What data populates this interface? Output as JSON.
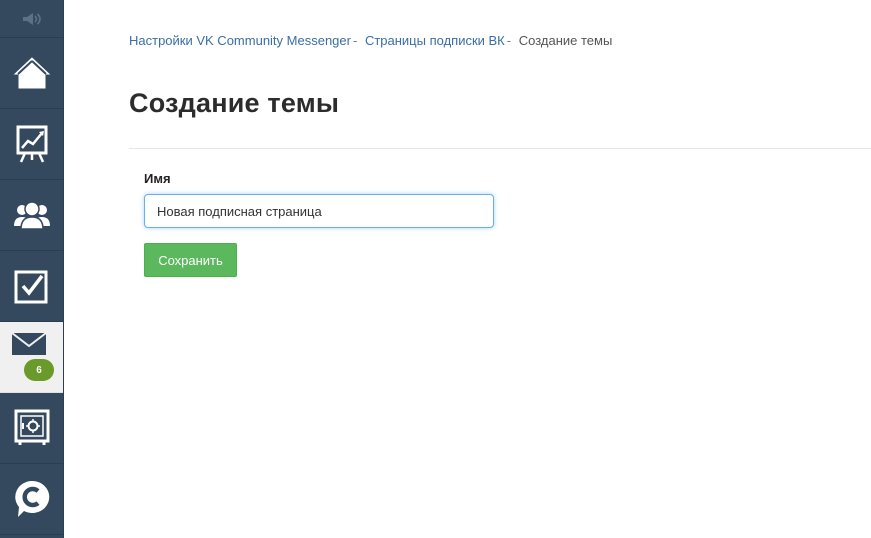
{
  "sidebar": {
    "items": [
      {
        "icon": "home-icon"
      },
      {
        "icon": "chart-easel-icon"
      },
      {
        "icon": "users-icon"
      },
      {
        "icon": "checkbox-icon"
      },
      {
        "icon": "mail-icon",
        "badge": "6",
        "active": true
      },
      {
        "icon": "safe-icon"
      },
      {
        "icon": "chat-bubble-icon"
      }
    ],
    "colors": {
      "background": "#34495e",
      "active": "#f0f0f0",
      "badge": "#6a9a2a"
    }
  },
  "breadcrumb": {
    "items": [
      {
        "label": "Настройки VK Community Messenger",
        "link": true
      },
      {
        "label": "Страницы подписки ВК",
        "link": true
      },
      {
        "label": "Создание темы",
        "link": false
      }
    ],
    "separator": "-"
  },
  "page": {
    "title": "Создание темы"
  },
  "form": {
    "name_label": "Имя",
    "name_value": "Новая подписная страница",
    "save_label": "Сохранить"
  },
  "colors": {
    "link": "#3a6ea5",
    "primary_button": "#5cb85c",
    "input_focus": "#66afe9"
  }
}
